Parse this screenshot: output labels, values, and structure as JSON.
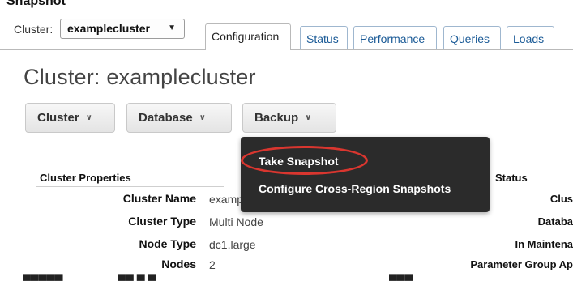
{
  "cropped_heading": "Snapshot",
  "cluster_selector": {
    "label": "Cluster:",
    "value": "examplecluster"
  },
  "tabs": [
    {
      "label": "Configuration",
      "active": true
    },
    {
      "label": "Status",
      "active": false
    },
    {
      "label": "Performance",
      "active": false
    },
    {
      "label": "Queries",
      "active": false
    },
    {
      "label": "Loads",
      "active": false
    }
  ],
  "page_title": "Cluster: examplecluster",
  "action_buttons": [
    {
      "label": "Cluster"
    },
    {
      "label": "Database"
    },
    {
      "label": "Backup"
    }
  ],
  "backup_menu": {
    "items": [
      {
        "label": "Take Snapshot",
        "highlighted": true
      },
      {
        "label": "Configure Cross-Region Snapshots",
        "highlighted": false
      }
    ],
    "highlight_color": "#d9362f"
  },
  "cluster_properties": {
    "title": "Cluster Properties",
    "rows": [
      {
        "label": "Cluster Name",
        "value": "examp"
      },
      {
        "label": "Cluster Type",
        "value": "Multi Node"
      },
      {
        "label": "Node Type",
        "value": "dc1.large"
      },
      {
        "label": "Nodes",
        "value": "2"
      }
    ]
  },
  "cluster_status": {
    "title": "Status",
    "rows": [
      {
        "label": "Clus"
      },
      {
        "label": "Databa"
      },
      {
        "label": "In Maintena"
      },
      {
        "label": "Parameter Group Ap"
      }
    ]
  }
}
